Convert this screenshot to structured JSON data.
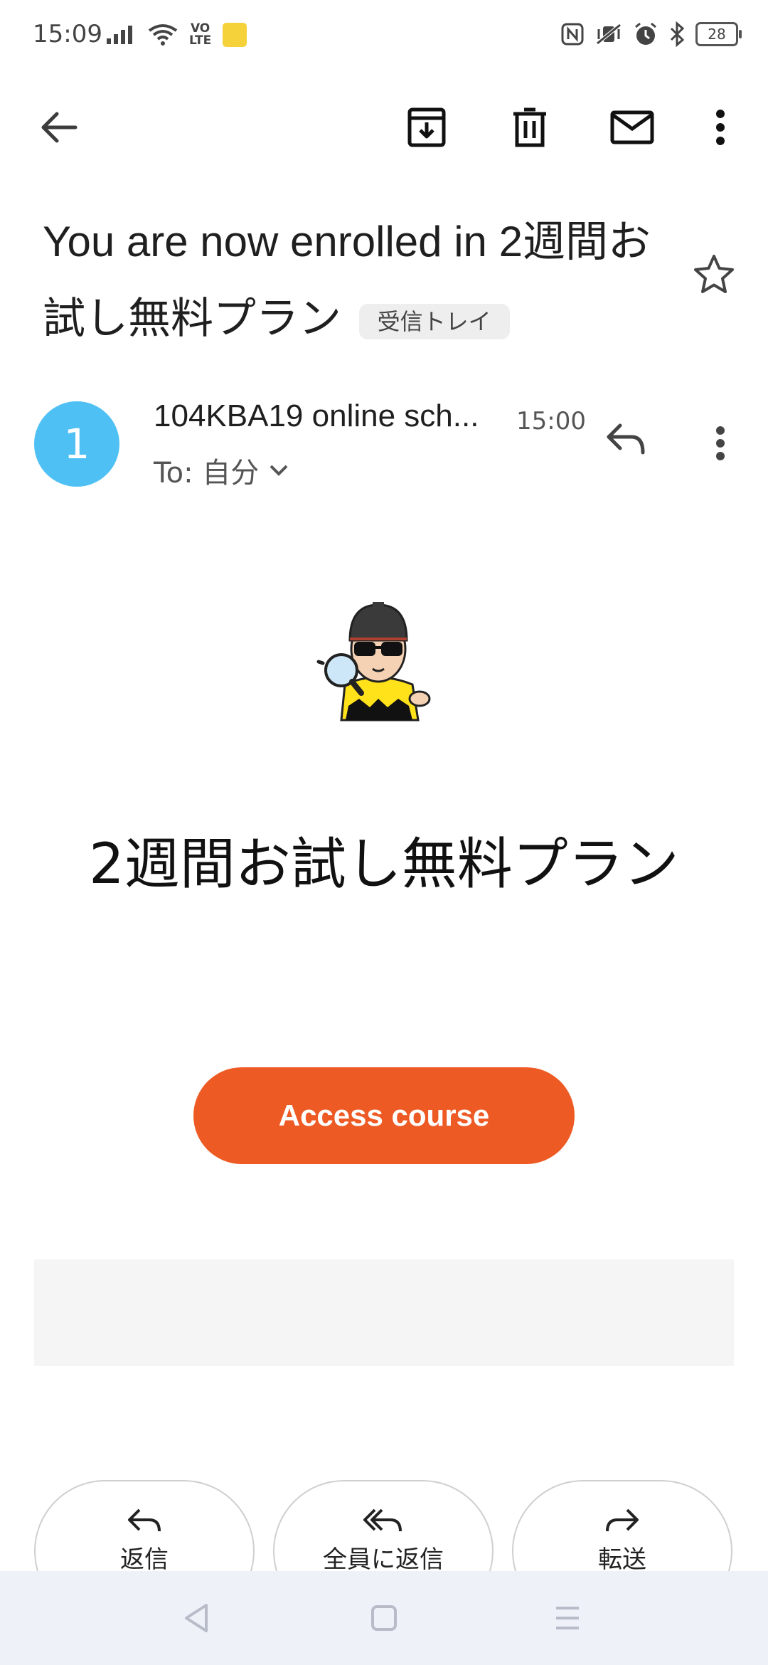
{
  "status_bar": {
    "time": "15:09",
    "volte_top": "VO",
    "volte_bottom": "LTE",
    "battery": "28"
  },
  "toolbar": {
    "back_icon": "arrow-left-icon",
    "archive_icon": "archive-icon",
    "delete_icon": "trash-icon",
    "mark_unread_icon": "envelope-icon",
    "more_icon": "more-vertical-icon"
  },
  "email": {
    "subject": "You are now enrolled in 2週間お試し無料プラン",
    "label": "受信トレイ",
    "avatar_letter": "1",
    "sender": "104KBA19 online sch...",
    "time": "15:00",
    "to": "To: 自分"
  },
  "body": {
    "hero_title": "2週間お試し無料プラン",
    "cta_label": "Access course"
  },
  "actions": [
    {
      "label": "返信"
    },
    {
      "label": "全員に返信"
    },
    {
      "label": "転送"
    }
  ],
  "colors": {
    "accent_button": "#ee5a24",
    "avatar": "#4fc0f4"
  }
}
